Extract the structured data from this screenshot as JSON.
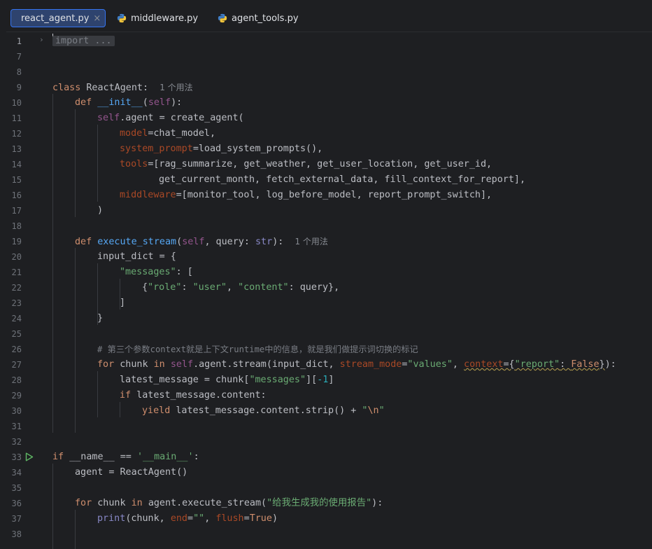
{
  "tabs": [
    {
      "label": "react_agent.py",
      "icon": "python-icon",
      "active": true,
      "close": "×"
    },
    {
      "label": "middleware.py",
      "icon": "python-icon",
      "active": false
    },
    {
      "label": "agent_tools.py",
      "icon": "python-icon",
      "active": false
    }
  ],
  "editor": {
    "current_line": 1,
    "lines": [
      {
        "n": "1"
      },
      {
        "n": "7"
      },
      {
        "n": "8"
      },
      {
        "n": "9"
      },
      {
        "n": "10"
      },
      {
        "n": "11"
      },
      {
        "n": "12"
      },
      {
        "n": "13"
      },
      {
        "n": "14"
      },
      {
        "n": "15"
      },
      {
        "n": "16"
      },
      {
        "n": "17"
      },
      {
        "n": "18"
      },
      {
        "n": "19"
      },
      {
        "n": "20"
      },
      {
        "n": "21"
      },
      {
        "n": "22"
      },
      {
        "n": "23"
      },
      {
        "n": "24"
      },
      {
        "n": "25"
      },
      {
        "n": "26"
      },
      {
        "n": "27"
      },
      {
        "n": "28"
      },
      {
        "n": "29"
      },
      {
        "n": "30"
      },
      {
        "n": "31"
      },
      {
        "n": "32"
      },
      {
        "n": "33"
      },
      {
        "n": "34"
      },
      {
        "n": "35"
      },
      {
        "n": "36"
      },
      {
        "n": "37"
      },
      {
        "n": "38"
      }
    ],
    "code": {
      "l1": {
        "kw": "import",
        "rest": " ..."
      },
      "l9": {
        "kw": "class ",
        "name": "ReactAgent",
        "colon": ":",
        "hint": "1 个用法"
      },
      "l10": {
        "kw": "def ",
        "fn": "__init__",
        "p1": "(",
        "self": "self",
        "p2": "):"
      },
      "l11": {
        "self": "self",
        "rest": ".agent = create_agent("
      },
      "l12": {
        "param": "model",
        "rest": "=chat_model,"
      },
      "l13": {
        "param": "system_prompt",
        "rest": "=load_system_prompts(),"
      },
      "l14": {
        "param": "tools",
        "rest": "=[rag_summarize, get_weather, get_user_location, get_user_id,"
      },
      "l15": {
        "rest": "get_current_month, fetch_external_data, fill_context_for_report],"
      },
      "l16": {
        "param": "middleware",
        "rest": "=[monitor_tool, log_before_model, report_prompt_switch],"
      },
      "l17": {
        "rest": ")"
      },
      "l19": {
        "kw": "def ",
        "fn": "execute_stream",
        "p1": "(",
        "self": "self",
        "p2": ", query: ",
        "type": "str",
        "p3": "):",
        "hint": "1 个用法"
      },
      "l20": {
        "rest": "input_dict = {"
      },
      "l21": {
        "str": "\"messages\"",
        "rest": ": ["
      },
      "l22": {
        "b1": "{",
        "s1": "\"role\"",
        "c1": ": ",
        "s2": "\"user\"",
        "c2": ", ",
        "s3": "\"content\"",
        "c3": ": query},"
      },
      "l23": {
        "rest": "]"
      },
      "l24": {
        "rest": "}"
      },
      "l26": {
        "cmt": "# 第三个参数context就是上下文runtime中的信息，就是我们做提示词切换的标记"
      },
      "l27": {
        "kw1": "for ",
        "a": "chunk ",
        "kw2": "in ",
        "self": "self",
        "b": ".agent.stream(input_dict, ",
        "p1": "stream_mode",
        "c": "=",
        "s1": "\"values\"",
        "d": ", ",
        "p2": "context",
        "e": "={",
        "s2": "\"report\"",
        "f": ": ",
        "kw3": "False",
        "g": "}):"
      },
      "l28": {
        "a": "latest_message = chunk[",
        "s": "\"messages\"",
        "b": "][",
        "num": "-1",
        "c": "]"
      },
      "l29": {
        "kw": "if ",
        "rest": "latest_message.content:"
      },
      "l30": {
        "kw": "yield ",
        "rest": "latest_message.content.strip() + ",
        "s1": "\"",
        "esc": "\\n",
        "s2": "\""
      },
      "l33": {
        "kw": "if ",
        "d1": "__name__",
        "a": " == ",
        "s": "'__main__'",
        "b": ":"
      },
      "l34": {
        "rest": "agent = ReactAgent()"
      },
      "l36": {
        "kw1": "for ",
        "a": "chunk ",
        "kw2": "in ",
        "b": "agent.execute_stream(",
        "s": "\"给我生成我的使用报告\"",
        "c": "):"
      },
      "l37": {
        "fn": "print",
        "a": "(chunk, ",
        "p1": "end",
        "b": "=",
        "s": "\"\"",
        "c": ", ",
        "p2": "flush",
        "d": "=",
        "kw": "True",
        "e": ")"
      }
    }
  },
  "colors": {
    "background": "#1e1f22",
    "keyword": "#cf8e6d",
    "function": "#56a8f5",
    "string": "#6aab73",
    "self": "#94558d",
    "param": "#aa4926",
    "comment": "#7a7e85",
    "active_tab": "#2e436e"
  }
}
